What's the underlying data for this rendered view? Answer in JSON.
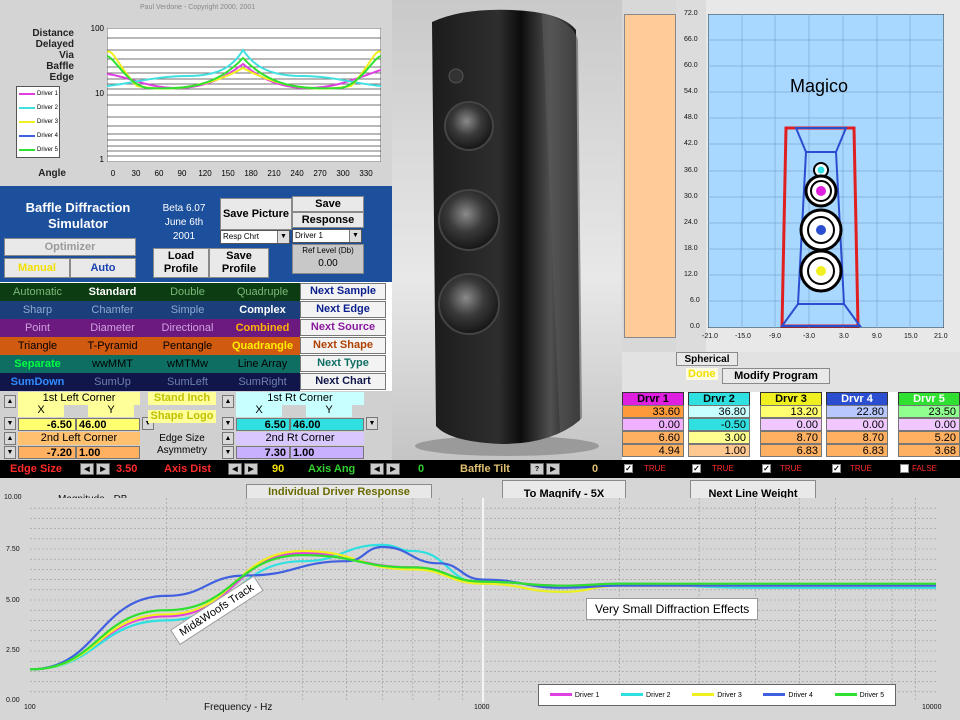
{
  "top_chart": {
    "copyright": "Paul Verdone - Copyright 2000, 2001",
    "side_label_1": "Distance",
    "side_label_2": "Delayed",
    "side_label_3": "Via",
    "side_label_4": "Baffle",
    "side_label_5": "Edge",
    "angle_label": "Angle",
    "y_ticks": [
      "100",
      "10",
      "1"
    ],
    "x_ticks": [
      "0",
      "30",
      "60",
      "90",
      "120",
      "150",
      "180",
      "210",
      "240",
      "270",
      "300",
      "330"
    ],
    "legend": [
      "Driver 1",
      "Driver 2",
      "Driver 3",
      "Driver 4",
      "Driver 5"
    ],
    "colors": [
      "#e040e0",
      "#40e0e0",
      "#f0f020",
      "#4060e0",
      "#30e030"
    ]
  },
  "control_panel": {
    "title_line1": "Baffle Diffraction",
    "title_line2": "Simulator",
    "beta": "Beta 6.07",
    "date": "June 6th",
    "year": "2001",
    "save_picture": "Save Picture",
    "save_response": "Save",
    "response_label": "Response",
    "resp_select": "Resp Chrt",
    "driver_select": "Driver 1",
    "ref_level_label": "Ref Level (Db)",
    "ref_level_value": "0.00",
    "optimizer": "Optimizer",
    "manual": "Manual",
    "auto": "Auto",
    "load_profile": "Load Profile",
    "save_profile": "Save Profile"
  },
  "option_rows": [
    {
      "items": [
        "Automatic",
        "Standard",
        "Double",
        "Quadruple"
      ],
      "next": "Next Sample"
    },
    {
      "items": [
        "Sharp",
        "Chamfer",
        "Simple",
        "Complex"
      ],
      "next": "Next Edge"
    },
    {
      "items": [
        "Point",
        "Diameter",
        "Directional",
        "Combined"
      ],
      "next": "Next Source"
    },
    {
      "items": [
        "Triangle",
        "T-Pyramid",
        "Pentangle",
        "Quadrangle"
      ],
      "next": "Next Shape"
    },
    {
      "items": [
        "Separate",
        "wwMMT",
        "wMTMw",
        "Line Array"
      ],
      "next": "Next Type"
    },
    {
      "items": [
        "SumDown",
        "SumUp",
        "SumLeft",
        "SumRight"
      ],
      "next": "Next Chart"
    }
  ],
  "corners": {
    "left_first": "1st Left Corner",
    "right_first": "1st Rt Corner",
    "left_second": "2nd Left Corner",
    "right_second": "2nd Rt Corner",
    "x": "X",
    "y": "Y",
    "l1x": "-6.50",
    "l1y": "46.00",
    "r1x": "6.50",
    "r1y": "46.00",
    "l2x": "-7.20",
    "l2y": "1.00",
    "r2x": "7.30",
    "r2y": "1.00",
    "stand_inch": "Stand Inch",
    "shape_logo": "Shape Logo",
    "edge_size_label": "Edge Size",
    "asymmetry_label": "Asymmetry"
  },
  "status_bar": {
    "edge_size_label": "Edge Size",
    "edge_size_value": "3.50",
    "axis_dist_label": "Axis Dist",
    "axis_dist_value": "90",
    "axis_ang_label": "Axis Ang",
    "axis_ang_value": "0",
    "baffle_tilt_label": "Baffle Tilt",
    "baffle_tilt_value": "0",
    "flags": [
      "TRUE",
      "TRUE",
      "TRUE",
      "TRUE",
      "FALSE"
    ]
  },
  "magico": {
    "label": "Magico",
    "y_ticks": [
      "72.0",
      "66.0",
      "60.0",
      "54.0",
      "48.0",
      "42.0",
      "36.0",
      "30.0",
      "24.0",
      "18.0",
      "12.0",
      "6.0",
      "0.0"
    ],
    "x_ticks": [
      "-21.0",
      "-15.0",
      "-9.0",
      "-3.0",
      "3.0",
      "9.0",
      "15.0",
      "21.0"
    ]
  },
  "program": {
    "spherical": "Spherical",
    "done": "Done",
    "modify": "Modify Program"
  },
  "driver_table": {
    "headers": [
      "Drvr 1",
      "Drvr 2",
      "Drvr 3",
      "Drvr 4",
      "Drvr 5"
    ],
    "rows": [
      [
        "33.60",
        "36.80",
        "13.20",
        "22.80",
        "23.50"
      ],
      [
        "0.00",
        "-0.50",
        "0.00",
        "0.00",
        "0.00"
      ],
      [
        "6.60",
        "3.00",
        "8.70",
        "8.70",
        "5.20"
      ],
      [
        "4.94",
        "1.00",
        "6.83",
        "6.83",
        "3.68"
      ]
    ]
  },
  "main_chart": {
    "title": "Individual Driver Response",
    "magnify": "To Magnify - 5X",
    "line_weight": "Next Line Weight",
    "y_title": "Magnitude - DB",
    "x_title": "Frequency - Hz",
    "y_ticks": [
      "10.00",
      "7.50",
      "5.00",
      "2.50",
      "0.00"
    ],
    "x_ticks": [
      "100",
      "1000",
      "10000"
    ],
    "annotation_1": "Very Small Diffraction Effects",
    "annotation_2": "Mid&Woofs Track",
    "legend": [
      "Driver 1",
      "Driver 2",
      "Driver 3",
      "Driver 4",
      "Driver 5"
    ]
  },
  "chart_data": {
    "type": "line",
    "title": "Individual Driver Response",
    "xlabel": "Frequency - Hz",
    "ylabel": "Magnitude - DB",
    "x_scale": "log",
    "xlim": [
      100,
      10000
    ],
    "ylim": [
      0,
      10
    ],
    "series": [
      {
        "name": "Driver 1",
        "color": "#e040e0",
        "x": [
          100,
          200,
          400,
          700,
          1000,
          1500,
          2000,
          4000,
          10000
        ],
        "y": [
          1.6,
          4.2,
          7.3,
          6.6,
          5.9,
          5.7,
          5.8,
          5.7,
          5.7
        ]
      },
      {
        "name": "Driver 2",
        "color": "#30e0e0",
        "x": [
          100,
          200,
          400,
          600,
          700,
          1000,
          1500,
          2000,
          4000,
          10000
        ],
        "y": [
          1.6,
          4.0,
          6.9,
          7.7,
          7.4,
          5.8,
          5.4,
          5.8,
          5.6,
          5.6
        ]
      },
      {
        "name": "Driver 3",
        "color": "#f0f020",
        "x": [
          100,
          200,
          400,
          700,
          1000,
          1500,
          2000,
          4000,
          10000
        ],
        "y": [
          1.6,
          4.3,
          7.4,
          6.5,
          5.8,
          5.4,
          5.7,
          5.7,
          5.7
        ]
      },
      {
        "name": "Driver 4",
        "color": "#4060e0",
        "x": [
          100,
          200,
          300,
          500,
          600,
          800,
          1000,
          1500,
          2000,
          4000,
          10000
        ],
        "y": [
          1.6,
          5.2,
          6.2,
          6.9,
          7.6,
          6.8,
          6.0,
          5.6,
          5.7,
          5.7,
          5.7
        ]
      },
      {
        "name": "Driver 5",
        "color": "#30e030",
        "x": [
          100,
          200,
          400,
          700,
          1000,
          1500,
          2000,
          4000,
          10000
        ],
        "y": [
          1.6,
          4.5,
          7.2,
          6.6,
          5.9,
          5.7,
          5.8,
          5.8,
          5.8
        ]
      }
    ]
  }
}
